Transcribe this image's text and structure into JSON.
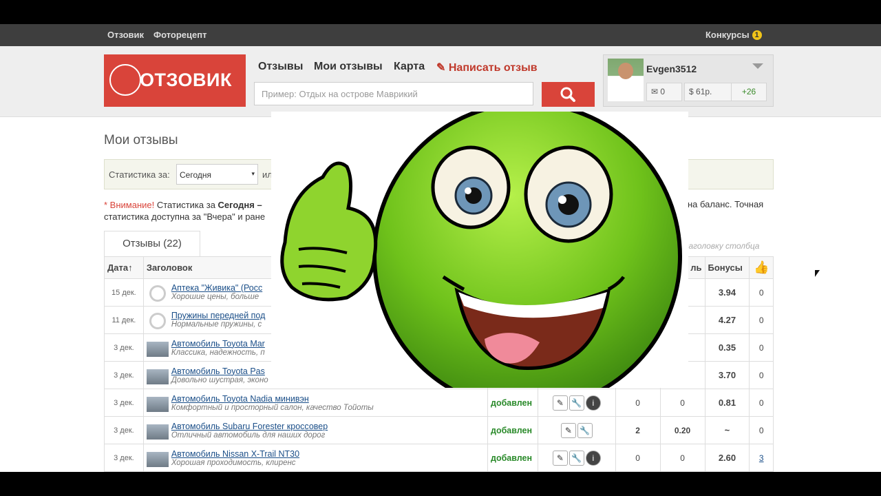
{
  "topbar": {
    "link1": "Отзовик",
    "link2": "Фоторецепт",
    "contests": "Конкурсы",
    "contests_count": "1"
  },
  "header": {
    "logo_text": "ОТЗОВИК",
    "nav": [
      "Отзывы",
      "Мои отзывы",
      "Карта"
    ],
    "write_review": "Написать отзыв",
    "search_placeholder": "Пример: Отдых на острове Маврикий"
  },
  "user": {
    "name": "Evgen3512",
    "messages": "0",
    "balance": "61р.",
    "rating": "+26"
  },
  "page": {
    "title": "Мои отзывы",
    "stats_label": "Статистика за:",
    "stats_select": "Сегодня",
    "stats_or": "ил",
    "warning_prefix": "* Внимание!",
    "warning_text": " Статистика за ",
    "warning_bold": "Сегодня –",
    "warning_line2": "статистика доступна за \"Вчера\" и ране",
    "warning_right": "на баланс. Точная",
    "tab": "Отзывы (22)",
    "sort_hint": "о заголовку столбца"
  },
  "table": {
    "headers": {
      "date": "Дата↑",
      "title": "Заголовок",
      "col_trunc": "ль",
      "bonus": "Бонусы"
    },
    "rows": [
      {
        "date": "15 дек.",
        "title": "Аптека \"Живика\" (Росс",
        "sub": "Хорошие цены, больше",
        "status": "",
        "c1": "",
        "c2": "",
        "bonus": "3.94",
        "likes": "0"
      },
      {
        "date": "11 дек.",
        "title": "Пружины передней под",
        "sub": "Нормальные пружины, с",
        "status": "",
        "c1": "",
        "c2": "",
        "bonus": "4.27",
        "likes": "0"
      },
      {
        "date": "3 дек.",
        "title": "Автомобиль Toyota Mar",
        "sub": "Классика, надежность, п",
        "status": "",
        "c1": "",
        "c2": "",
        "bonus": "0.35",
        "likes": "0"
      },
      {
        "date": "3 дек.",
        "title": "Автомобиль Toyota Pas",
        "sub": "Довольно шустрая, эконо",
        "status": "",
        "c1": "",
        "c2": "",
        "bonus": "3.70",
        "likes": "0"
      },
      {
        "date": "3 дек.",
        "title": "Автомобиль Toyota Nadia минивэн",
        "sub": "Комфортный и просторный салон, качество Тойоты",
        "status": "добавлен",
        "c1": "0",
        "c2": "0",
        "bonus": "0.81",
        "likes": "0"
      },
      {
        "date": "3 дек.",
        "title": "Автомобиль Subaru Forester кроссовер",
        "sub": "Отличный автомобиль для наших дорог",
        "status": "добавлен",
        "c1": "2",
        "c2": "0.20",
        "bonus": "~",
        "likes": "0"
      },
      {
        "date": "3 дек.",
        "title": "Автомобиль Nissan X-Trail NT30",
        "sub": "Хорошая проходимость, клиренс",
        "status": "добавлен",
        "c1": "0",
        "c2": "0",
        "bonus": "2.60",
        "likes": "3"
      }
    ]
  },
  "colors": {
    "brand_red": "#d9443a",
    "smiley_green": "#7ccb1e"
  }
}
